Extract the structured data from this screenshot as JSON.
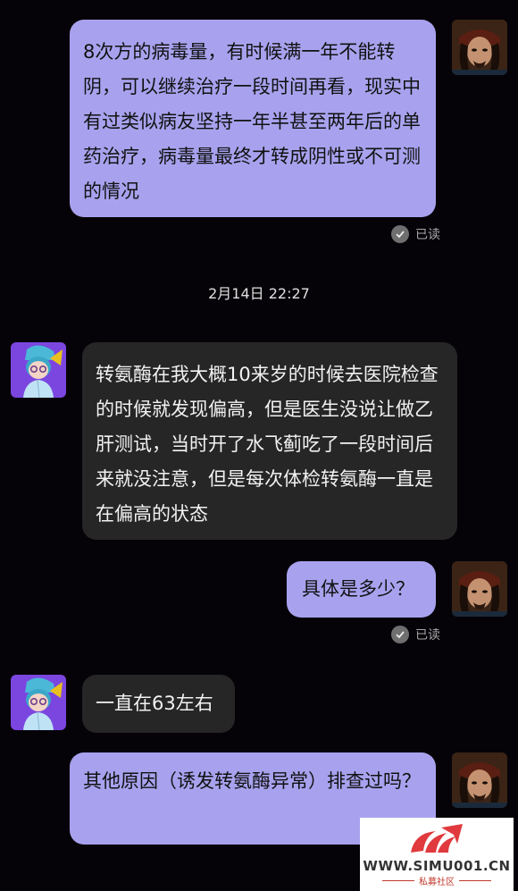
{
  "messages": [
    {
      "side": "out",
      "text": "8次方的病毒量，有时候满一年不能转阴，可以继续治疗一段时间再看，现实中有过类似病友坚持一年半甚至两年后的单药治疗，病毒量最终才转成阴性或不可测的情况"
    },
    {
      "side": "in",
      "text": "转氨酶在我大概10来岁的时候去医院检查的时候就发现偏高，但是医生没说让做乙肝测试，当时开了水飞蓟吃了一段时间后来就没注意，但是每次体检转氨酶一直是在偏高的状态"
    },
    {
      "side": "out",
      "text": "具体是多少？"
    },
    {
      "side": "in",
      "text": "一直在63左右"
    },
    {
      "side": "out",
      "text": "其他原因（诱发转氨酶异常）排查过吗？"
    }
  ],
  "read_label": "已读",
  "timestamp": "2月14日 22:27",
  "watermark": {
    "url": "WWW.SIMU001.CN",
    "subtitle": "私募社区"
  },
  "colors": {
    "background": "#060308",
    "outgoing_bubble": "#a8a2ee",
    "incoming_bubble": "#262626"
  }
}
